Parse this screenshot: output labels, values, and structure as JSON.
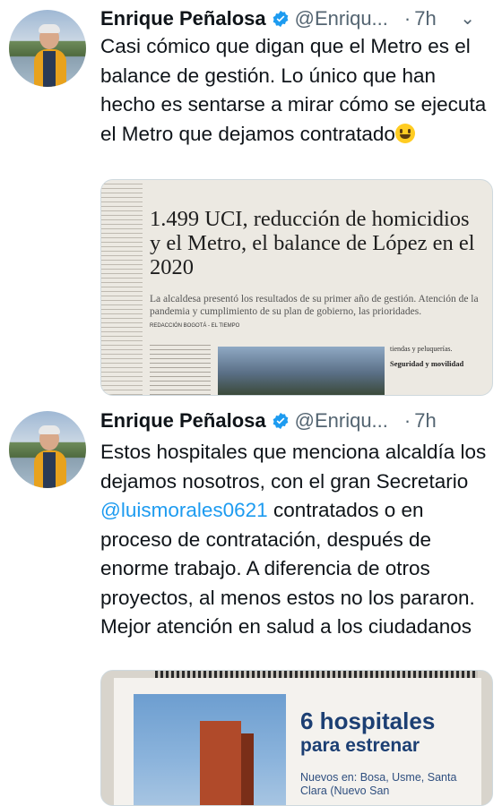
{
  "tweets": [
    {
      "author_name": "Enrique Peñalosa",
      "handle": "@Enriqu...",
      "separator": "·",
      "time": "7h",
      "text": "Casi cómico que digan que el Metro es el balance de gestión. Lo único que han hecho es sentarse a mirar cómo se ejecuta el Metro que dejamos contratado",
      "media": {
        "headline": "1.499 UCI, reducción de homicidios y el Metro, el balance de López en el 2020",
        "subhead": "La alcaldesa presentó los resultados de su primer año de gestión. Atención de la pandemia y cumplimiento de su plan de gobierno, las prioridades.",
        "credit": "REDACCIÓN BOGOTÁ - EL TIEMPO",
        "right_col_1": "tiendas y peluquerías.",
        "right_col_2": "Seguridad y movilidad"
      }
    },
    {
      "author_name": "Enrique Peñalosa",
      "handle": "@Enriqu...",
      "separator": "·",
      "time": "7h",
      "text_before": "Estos hospitales que menciona alcaldía los dejamos nosotros, con el gran Secretario ",
      "mention": "@luismorales0621",
      "text_after": " contratados o en proceso de contratación, después de enorme trabajo. A diferencia de otros proyectos, al menos estos no los pararon. Mejor atención en salud a los ciudadanos",
      "media": {
        "title": "6 hospitales",
        "title2": "para estrenar",
        "small": "Nuevos en: Bosa, Usme, Santa Clara (Nuevo San"
      }
    }
  ],
  "colors": {
    "accent": "#1d9bf0",
    "verified": "#1d9bf0",
    "text": "#0f1419",
    "secondary": "#536471"
  },
  "icons": [
    "verified-badge-icon",
    "chevron-down-icon",
    "grinning-face-emoji"
  ]
}
